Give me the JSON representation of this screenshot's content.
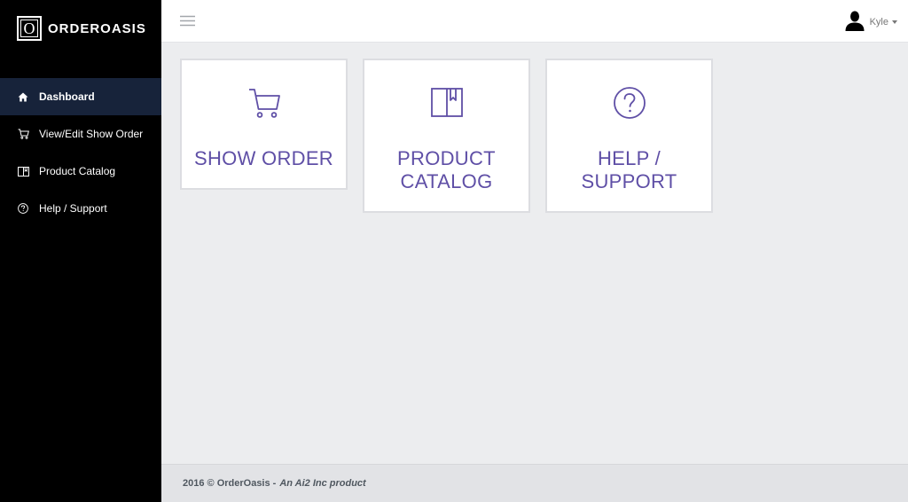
{
  "brand": {
    "mark": "O",
    "name": "ORDEROASIS"
  },
  "sidebar": {
    "items": [
      {
        "label": "Dashboard",
        "icon": "home-icon",
        "active": true
      },
      {
        "label": "View/Edit Show Order",
        "icon": "cart-icon",
        "active": false
      },
      {
        "label": "Product Catalog",
        "icon": "book-icon",
        "active": false
      },
      {
        "label": "Help / Support",
        "icon": "question-circle-icon",
        "active": false
      }
    ]
  },
  "topbar": {
    "menu_icon": "hamburger-icon",
    "user": {
      "name": "Kyle",
      "avatar_icon": "user-silhouette-icon"
    }
  },
  "cards": [
    {
      "line1": "SHOW ORDER",
      "line2": "",
      "icon": "cart-icon"
    },
    {
      "line1": "PRODUCT",
      "line2": "CATALOG",
      "icon": "book-icon"
    },
    {
      "line1": "HELP /",
      "line2": "SUPPORT",
      "icon": "question-circle-icon"
    }
  ],
  "footer": {
    "text": "2016 © OrderOasis -",
    "tagline": "An Ai2 Inc product"
  },
  "colors": {
    "accent": "#5f4fa6",
    "sidebar_bg": "#000000",
    "sidebar_active": "#17233a",
    "page_bg": "#ecedef"
  }
}
